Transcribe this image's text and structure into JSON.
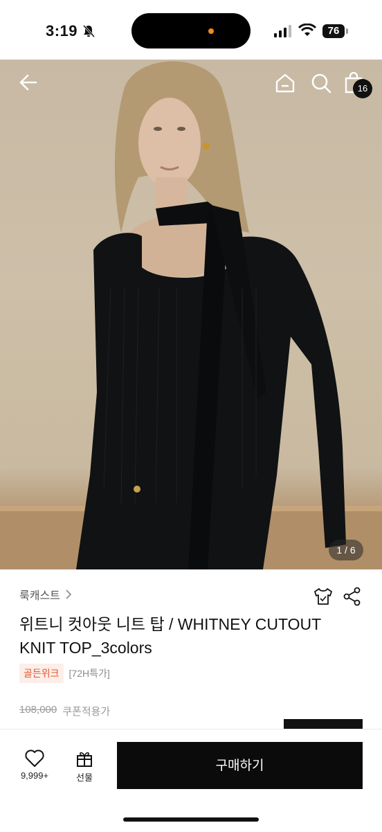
{
  "status_bar": {
    "time": "3:19",
    "battery": "76"
  },
  "top_nav": {
    "back_icon": "arrow-left-icon",
    "home_icon": "home-icon",
    "search_icon": "search-icon",
    "bag_icon": "shopping-bag-icon",
    "cart_count": "16"
  },
  "gallery": {
    "counter": "1 / 6"
  },
  "product": {
    "brand": "룩캐스트",
    "title": "위트니 컷아웃 니트 탑 / WHITNEY CUTOUT KNIT TOP_3colors",
    "tags": [
      "골든위크",
      "[72H특가]"
    ],
    "original_price": "108,000",
    "coupon_label": "쿠폰적용가"
  },
  "bottom_bar": {
    "like_count": "9,999+",
    "gift_label": "선물",
    "buy_label": "구매하기"
  },
  "colors": {
    "accent": "#e2562a",
    "primary_button": "#0b0b0b"
  }
}
